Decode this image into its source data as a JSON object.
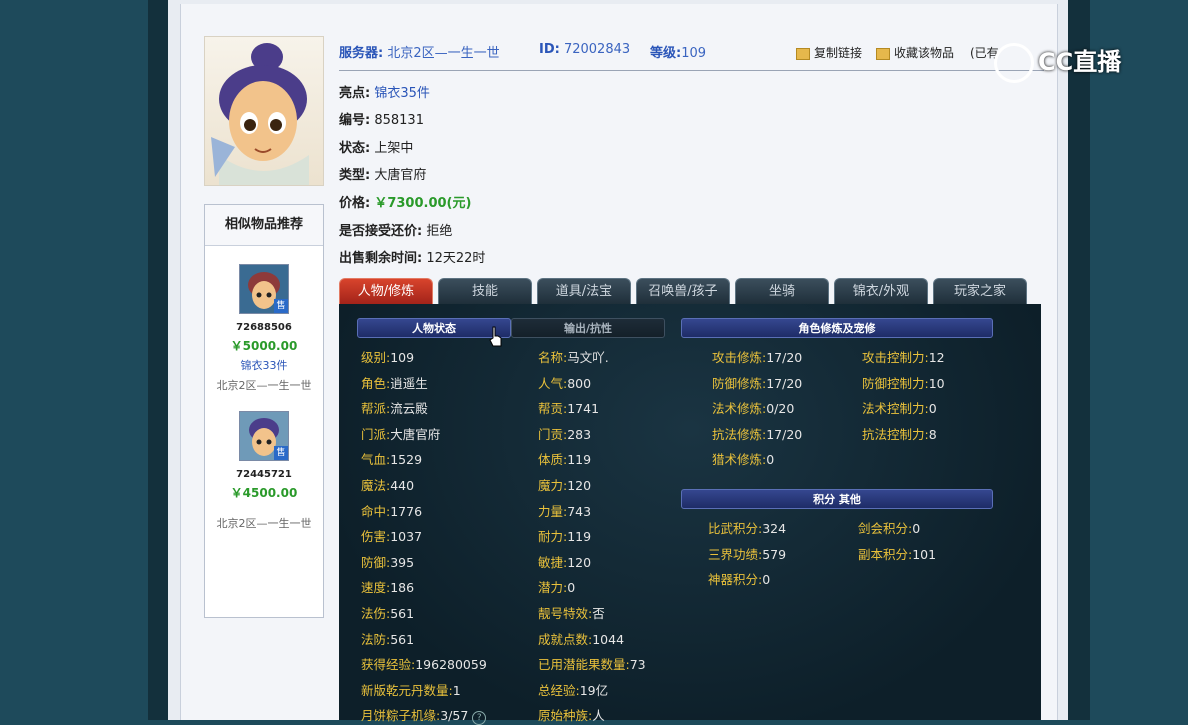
{
  "header": {
    "server_label": "服务器:",
    "server_value": "北京2区—一生一世",
    "id_label": "ID:",
    "id_value": "72002843",
    "level_label": "等级:",
    "level_value": "109",
    "copy_link": "复制链接",
    "favorite": "收藏该物品",
    "favorite_count_prefix": "(已有"
  },
  "info": {
    "highlight_label": "亮点:",
    "highlight_value": "锦衣35件",
    "number_label": "编号:",
    "number_value": "858131",
    "status_label": "状态:",
    "status_value": "上架中",
    "type_label": "类型:",
    "type_value": "大唐官府",
    "price_label": "价格:",
    "price_value": "￥7300.00(元)",
    "counteroffer_label": "是否接受还价:",
    "counteroffer_value": "拒绝",
    "time_label": "出售剩余时间:",
    "time_value": "12天22时"
  },
  "similar": {
    "title": "相似物品推荐",
    "items": [
      {
        "id": "72688506",
        "price": "￥5000.00",
        "tag": "锦衣33件",
        "server": "北京2区—一生一世",
        "badge": "售"
      },
      {
        "id": "72445721",
        "price": "￥4500.00",
        "tag": "",
        "server": "北京2区—一生一世",
        "badge": "售"
      }
    ]
  },
  "tabs": [
    "人物/修炼",
    "技能",
    "道具/法宝",
    "召唤兽/孩子",
    "坐骑",
    "锦衣/外观",
    "玩家之家"
  ],
  "panel": {
    "subtab_active": "人物状态",
    "subtab_other": "输出/抗性",
    "cultivation_title": "角色修炼及宠修",
    "score_title": "积分 其他",
    "left_col": [
      {
        "k": "级别:",
        "v": "109"
      },
      {
        "k": "角色:",
        "v": "逍遥生"
      },
      {
        "k": "帮派:",
        "v": "流云殿"
      },
      {
        "k": "门派:",
        "v": "大唐官府"
      },
      {
        "k": "气血:",
        "v": "1529"
      },
      {
        "k": "魔法:",
        "v": "440"
      },
      {
        "k": "命中:",
        "v": "1776"
      },
      {
        "k": "伤害:",
        "v": "1037"
      },
      {
        "k": "防御:",
        "v": "395"
      },
      {
        "k": "速度:",
        "v": "186"
      },
      {
        "k": "法伤:",
        "v": "561"
      },
      {
        "k": "法防:",
        "v": "561"
      },
      {
        "k": "获得经验:",
        "v": "196280059"
      },
      {
        "k": "新版乾元丹数量:",
        "v": "1"
      },
      {
        "k": "月饼粽子机缘:",
        "v": "3/57"
      }
    ],
    "mid_col": [
      {
        "k": "名称:",
        "v": "马文吖."
      },
      {
        "k": "人气:",
        "v": "800"
      },
      {
        "k": "帮贡:",
        "v": "1741"
      },
      {
        "k": "门贡:",
        "v": "283"
      },
      {
        "k": "体质:",
        "v": "119"
      },
      {
        "k": "魔力:",
        "v": "120"
      },
      {
        "k": "力量:",
        "v": "743"
      },
      {
        "k": "耐力:",
        "v": "119"
      },
      {
        "k": "敏捷:",
        "v": "120"
      },
      {
        "k": "潜力:",
        "v": "0"
      },
      {
        "k": "靓号特效:",
        "v": "否"
      },
      {
        "k": "成就点数:",
        "v": "1044"
      },
      {
        "k": "已用潜能果数量:",
        "v": "73"
      },
      {
        "k": "总经验:",
        "v": "19亿"
      },
      {
        "k": "原始种族:",
        "v": "人"
      }
    ],
    "cultivation": [
      {
        "k": "攻击修炼:",
        "v": "17/20",
        "k2": "攻击控制力:",
        "v2": "12"
      },
      {
        "k": "防御修炼:",
        "v": "17/20",
        "k2": "防御控制力:",
        "v2": "10"
      },
      {
        "k": "法术修炼:",
        "v": "0/20",
        "k2": "法术控制力:",
        "v2": "0"
      },
      {
        "k": "抗法修炼:",
        "v": "17/20",
        "k2": "抗法控制力:",
        "v2": "8"
      },
      {
        "k": "猎术修炼:",
        "v": "0",
        "k2": "",
        "v2": ""
      }
    ],
    "scores": [
      {
        "k": "比武积分:",
        "v": "324",
        "k2": "剑会积分:",
        "v2": "0"
      },
      {
        "k": "三界功绩:",
        "v": "579",
        "k2": "副本积分:",
        "v2": "101"
      },
      {
        "k": "神器积分:",
        "v": "0",
        "k2": "",
        "v2": ""
      }
    ]
  },
  "watermark": "CC直播"
}
